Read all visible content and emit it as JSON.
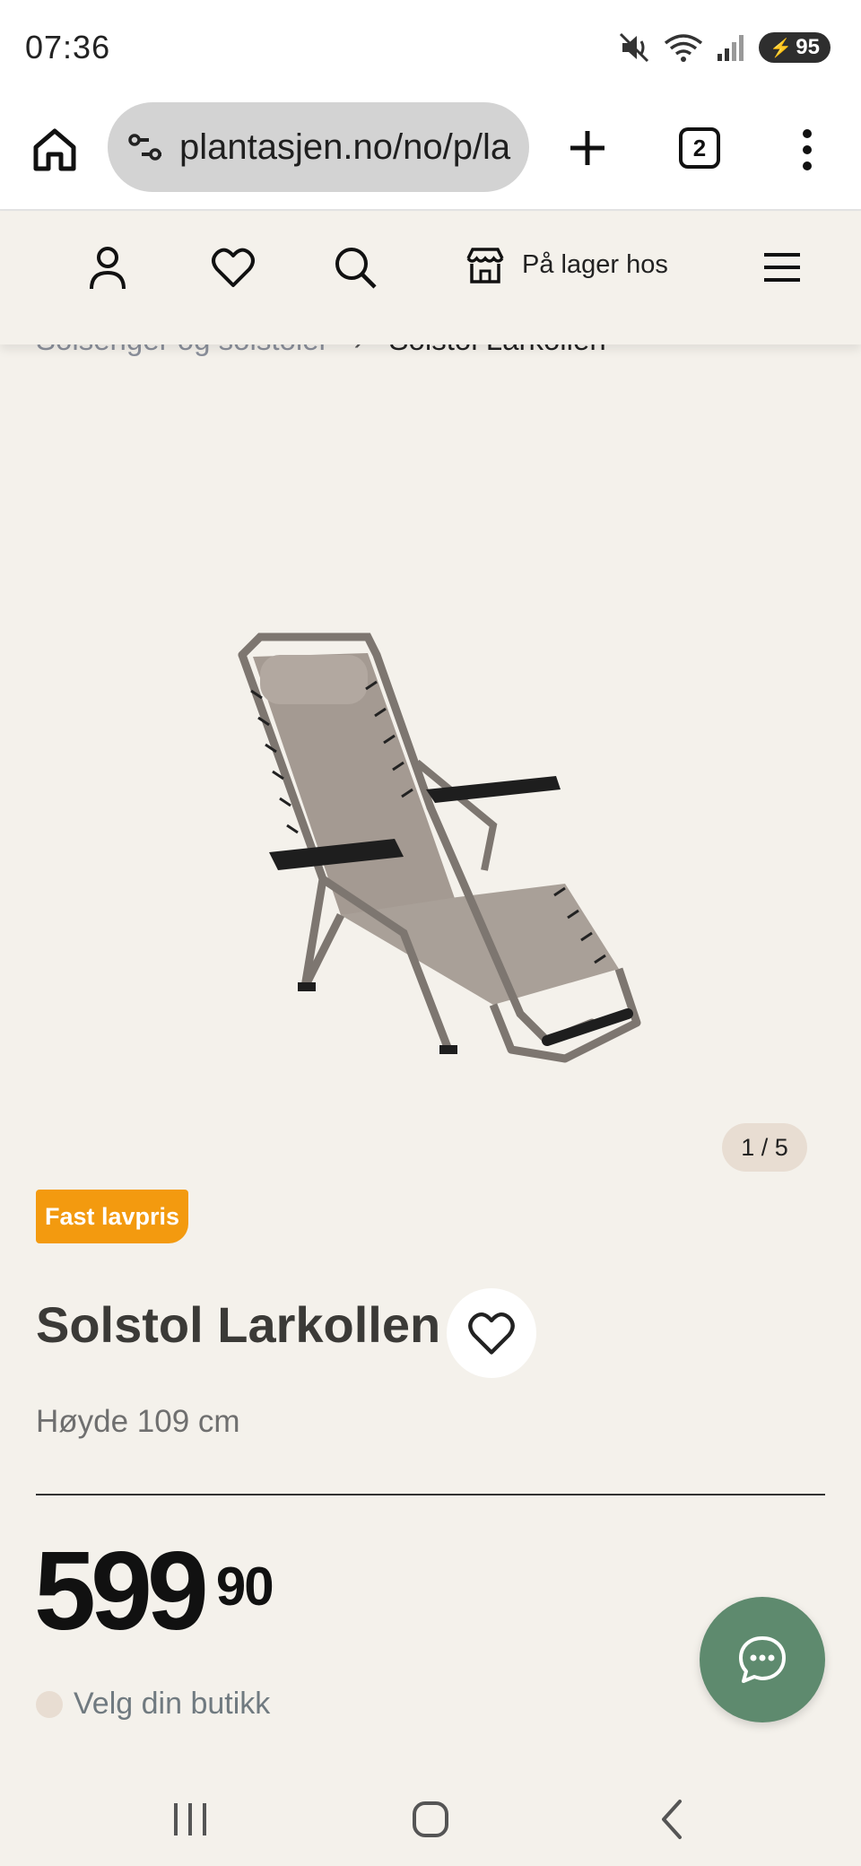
{
  "status_bar": {
    "time": "07:36",
    "battery": "95",
    "icons": [
      "mute-icon",
      "wifi-icon",
      "signal-icon",
      "battery-icon"
    ]
  },
  "browser": {
    "url": "plantasjen.no/no/p/la",
    "tab_count": "2",
    "icons": [
      "home-icon",
      "site-settings-icon",
      "plus-icon",
      "tabs-icon",
      "more-vert-icon"
    ]
  },
  "header": {
    "stock_label": "På lager hos",
    "icons": [
      "user-icon",
      "heart-icon",
      "search-icon",
      "store-icon",
      "hamburger-icon"
    ]
  },
  "breadcrumb": {
    "parent": "Solsenger og solstoler",
    "separator": "›",
    "current": "Solstol Larkollen"
  },
  "gallery": {
    "pager": "1 / 5"
  },
  "product": {
    "badge": "Fast lavpris",
    "title": "Solstol Larkollen",
    "subtitle": "Høyde 109 cm",
    "price_main": "599",
    "price_cents": "90",
    "store_label": "Velg din butikk"
  },
  "colors": {
    "background": "#f4f1eb",
    "badge": "#f39a0f",
    "chat_button": "#5e8a6e",
    "pager_bg": "#e8ddd2"
  },
  "navigation": {
    "icons": [
      "recent-apps-icon",
      "home-circle-icon",
      "back-icon"
    ]
  }
}
